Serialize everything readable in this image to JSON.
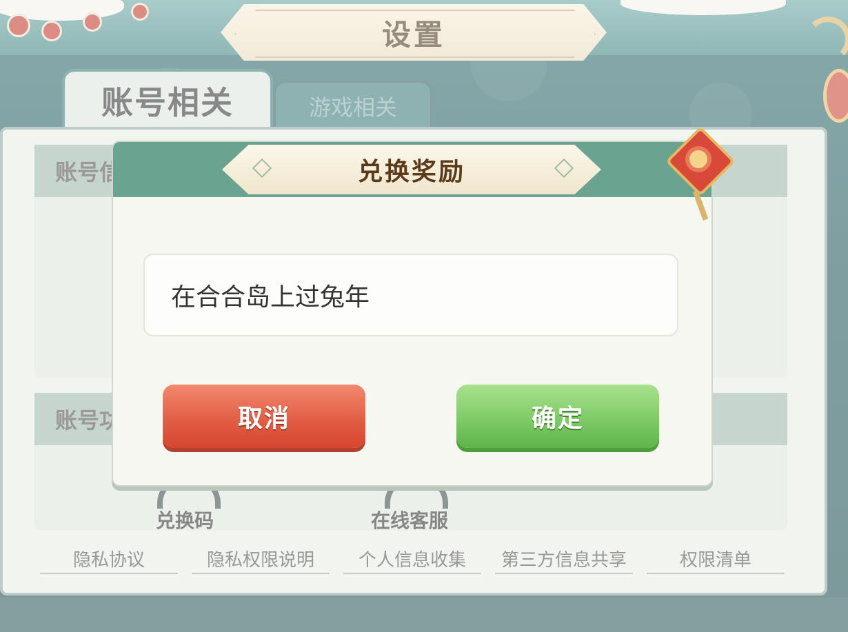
{
  "settings": {
    "title": "设置",
    "tabs": [
      {
        "label": "账号相关",
        "active": true
      },
      {
        "label": "游戏相关",
        "active": false
      }
    ],
    "sections": [
      {
        "label": "账号信"
      },
      {
        "label": "账号功"
      }
    ],
    "shortcuts": [
      {
        "label": "兑换码",
        "icon": "redeem-icon"
      },
      {
        "label": "在线客服",
        "icon": "headset-icon"
      }
    ],
    "links": [
      "隐私协议",
      "隐私权限说明",
      "个人信息收集",
      "第三方信息共享",
      "权限清单"
    ]
  },
  "dialog": {
    "title": "兑换奖励",
    "input_value": "在合合岛上过兔年",
    "cancel_label": "取消",
    "confirm_label": "确定"
  },
  "colors": {
    "teal": "#3f8482",
    "cancel_red": "#e25f46",
    "confirm_green": "#7fcb67",
    "title_brown": "#5a3a1a"
  }
}
